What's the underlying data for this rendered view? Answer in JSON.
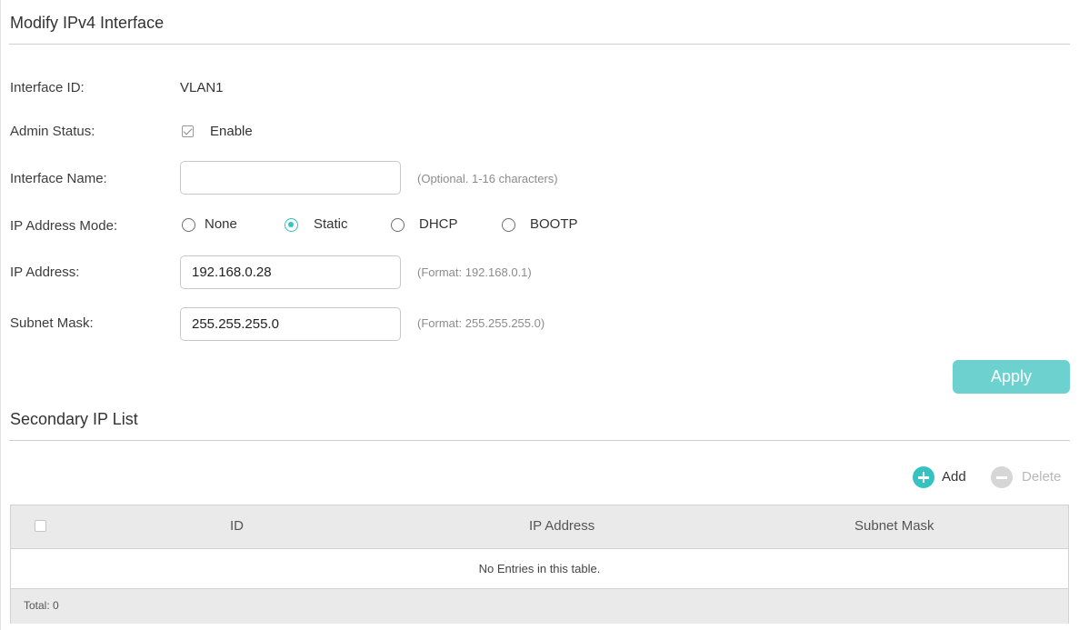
{
  "modify_section": {
    "title": "Modify IPv4 Interface"
  },
  "form": {
    "interface_id": {
      "label": "Interface ID:",
      "value": "VLAN1"
    },
    "admin_status": {
      "label": "Admin Status:",
      "checkbox_label": "Enable",
      "checked": true
    },
    "interface_name": {
      "label": "Interface Name:",
      "value": "",
      "hint": "(Optional. 1-16 characters)"
    },
    "ip_mode": {
      "label": "IP Address Mode:",
      "options": [
        "None",
        "Static",
        "DHCP",
        "BOOTP"
      ],
      "selected": "Static"
    },
    "ip_address": {
      "label": "IP Address:",
      "value": "192.168.0.28",
      "hint": "(Format: 192.168.0.1)"
    },
    "subnet_mask": {
      "label": "Subnet Mask:",
      "value": "255.255.255.0",
      "hint": "(Format: 255.255.255.0)"
    },
    "apply_label": "Apply"
  },
  "secondary_section": {
    "title": "Secondary IP List",
    "add_label": "Add",
    "delete_label": "Delete",
    "columns": [
      "ID",
      "IP Address",
      "Subnet Mask"
    ],
    "empty_message": "No Entries in this table.",
    "total_label": "Total: 0"
  },
  "colors": {
    "accent": "#36c2c0",
    "apply_button": "#6dd2cf",
    "delete_disabled": "#d6d6d6",
    "table_header": "#eaeaea"
  },
  "icons": {
    "add": "plus-circle-icon",
    "delete": "minus-circle-icon"
  }
}
